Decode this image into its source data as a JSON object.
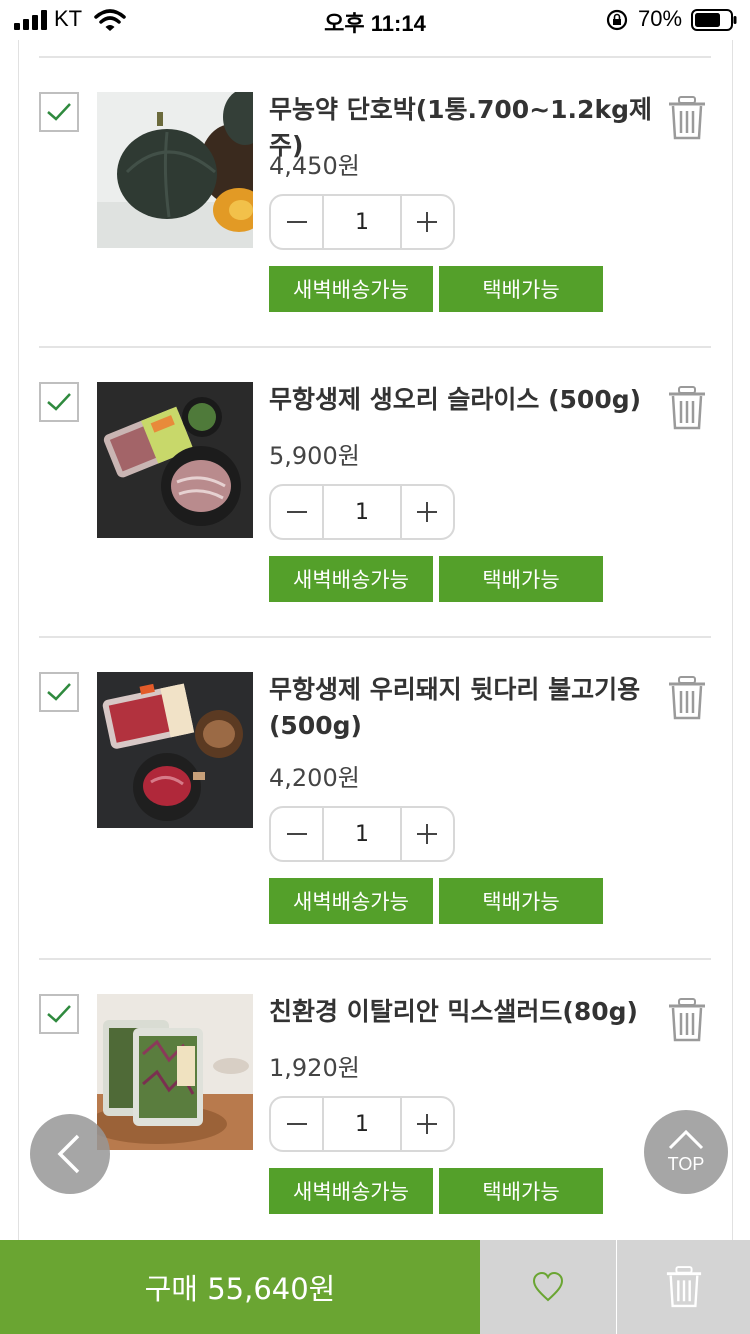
{
  "status_bar": {
    "carrier": "KT",
    "time": "오후 11:14",
    "battery": "70%"
  },
  "cart": {
    "items": [
      {
        "name": "무농약 단호박(1통.700~1.2kg제주)",
        "price": "4,450원",
        "quantity": "1",
        "badge_dawn": "새벽배송가능",
        "badge_parcel": "택배가능",
        "checked": true,
        "image": "pumpkin-photo"
      },
      {
        "name": "무항생제 생오리 슬라이스 (500g)",
        "price": "5,900원",
        "quantity": "1",
        "badge_dawn": "새벽배송가능",
        "badge_parcel": "택배가능",
        "checked": true,
        "image": "duck-slice-photo"
      },
      {
        "name": "무항생제 우리돼지 뒷다리 불고기용 (500g)",
        "price": "4,200원",
        "quantity": "1",
        "badge_dawn": "새벽배송가능",
        "badge_parcel": "택배가능",
        "checked": true,
        "image": "pork-bulgogi-photo"
      },
      {
        "name": "친환경 이탈리안 믹스샐러드(80g)",
        "price": "1,920원",
        "quantity": "1",
        "badge_dawn": "새벽배송가능",
        "badge_parcel": "택배가능",
        "checked": true,
        "image": "salad-photo"
      }
    ]
  },
  "fab": {
    "top_label": "TOP"
  },
  "bottom_bar": {
    "buy_label": "구매 55,640원"
  },
  "colors": {
    "accent_green": "#54a02a",
    "buy_green": "#6aa532",
    "check_green": "#2f8a3e"
  },
  "icons": [
    "signal-icon",
    "wifi-icon",
    "rotation-lock-icon",
    "battery-icon",
    "checkmark-icon",
    "trash-icon",
    "minus-icon",
    "plus-icon",
    "chevron-left-icon",
    "chevron-up-icon",
    "heart-icon"
  ]
}
